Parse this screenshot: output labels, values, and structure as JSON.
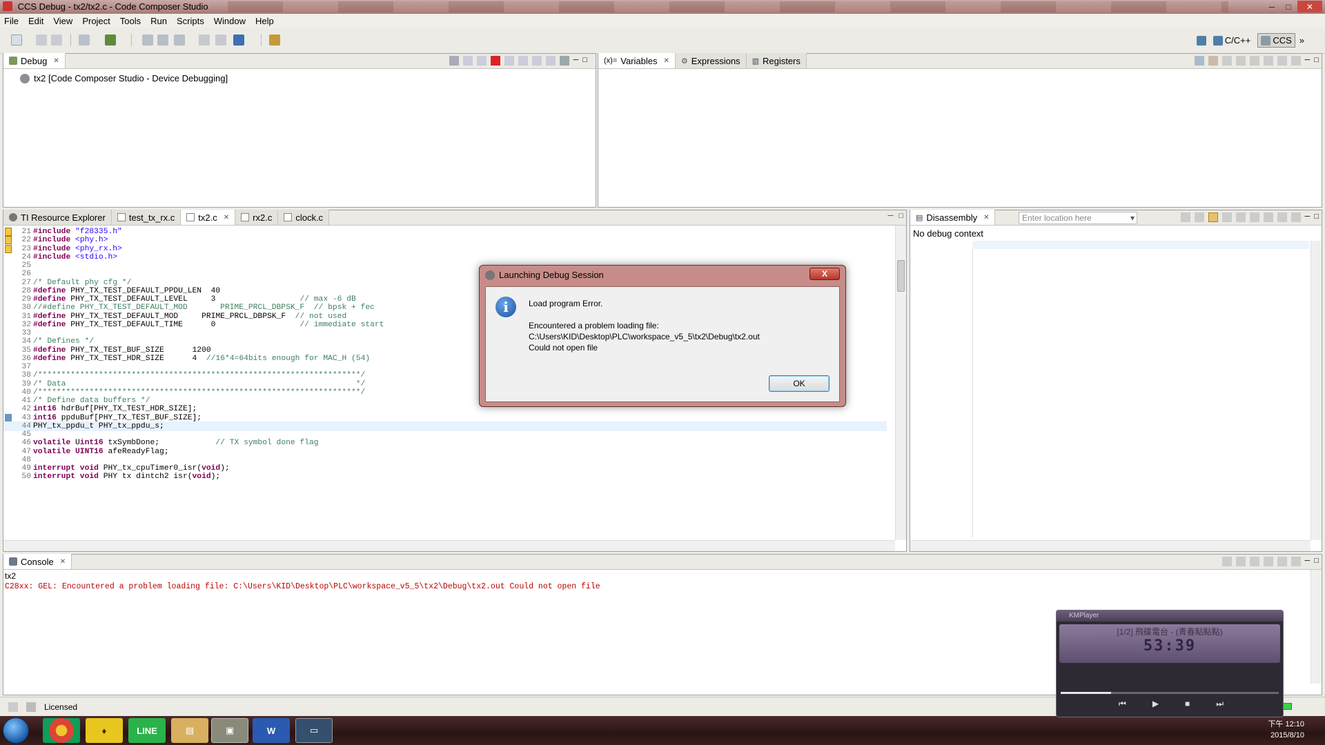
{
  "window": {
    "title": "CCS Debug - tx2/tx2.c - Code Composer Studio"
  },
  "menu": [
    "File",
    "Edit",
    "View",
    "Project",
    "Tools",
    "Run",
    "Scripts",
    "Window",
    "Help"
  ],
  "perspectives": {
    "cpp": "C/C++",
    "ccs": "CCS"
  },
  "debug_view": {
    "tab": "Debug",
    "item": "tx2 [Code Composer Studio - Device Debugging]"
  },
  "variables_view": {
    "tabs": [
      "Variables",
      "Expressions",
      "Registers"
    ]
  },
  "editor": {
    "tabs": [
      "TI Resource Explorer",
      "test_tx_rx.c",
      "tx2.c",
      "rx2.c",
      "clock.c"
    ],
    "active_tab": "tx2.c",
    "lines": [
      {
        "n": "21",
        "t": "#include \"f28335.h\""
      },
      {
        "n": "22",
        "t": "#include <phy.h>"
      },
      {
        "n": "23",
        "t": "#include <phy_rx.h>"
      },
      {
        "n": "24",
        "t": "#include <stdio.h>"
      },
      {
        "n": "25",
        "t": ""
      },
      {
        "n": "26",
        "t": ""
      },
      {
        "n": "27",
        "t": "/* Default phy cfg */"
      },
      {
        "n": "28",
        "t": "#define PHY_TX_TEST_DEFAULT_PPDU_LEN  40"
      },
      {
        "n": "29",
        "t": "#define PHY_TX_TEST_DEFAULT_LEVEL     3                  // max -6 dB"
      },
      {
        "n": "30",
        "t": "//#define PHY_TX_TEST_DEFAULT_MOD       PRIME_PRCL_DBPSK_F  // bpsk + fec"
      },
      {
        "n": "31",
        "t": "#define PHY_TX_TEST_DEFAULT_MOD     PRIME_PRCL_DBPSK_F  // not used"
      },
      {
        "n": "32",
        "t": "#define PHY_TX_TEST_DEFAULT_TIME      0                  // immediate start"
      },
      {
        "n": "33",
        "t": ""
      },
      {
        "n": "34",
        "t": "/* Defines */"
      },
      {
        "n": "35",
        "t": "#define PHY_TX_TEST_BUF_SIZE      1200"
      },
      {
        "n": "36",
        "t": "#define PHY_TX_TEST_HDR_SIZE      4  //16*4=64bits enough for MAC_H (54)"
      },
      {
        "n": "37",
        "t": ""
      },
      {
        "n": "38",
        "t": "/*********************************************************************/"
      },
      {
        "n": "39",
        "t": "/* Data                                                              */"
      },
      {
        "n": "40",
        "t": "/*********************************************************************/"
      },
      {
        "n": "41",
        "t": "/* Define data buffers */"
      },
      {
        "n": "42",
        "t": "int16 hdrBuf[PHY_TX_TEST_HDR_SIZE];"
      },
      {
        "n": "43",
        "t": "int16 ppduBuf[PHY_TX_TEST_BUF_SIZE];"
      },
      {
        "n": "44",
        "t": "PHY_tx_ppdu_t PHY_tx_ppdu_s;"
      },
      {
        "n": "45",
        "t": ""
      },
      {
        "n": "46",
        "t": "volatile Uint16 txSymbDone;            // TX symbol done flag"
      },
      {
        "n": "47",
        "t": "volatile UINT16 afeReadyFlag;"
      },
      {
        "n": "48",
        "t": ""
      },
      {
        "n": "49",
        "t": "interrupt void PHY_tx_cpuTimer0_isr(void);"
      },
      {
        "n": "50",
        "t": "interrupt void PHY tx dintch2 isr(void);"
      }
    ]
  },
  "disassembly": {
    "tab": "Disassembly",
    "location_placeholder": "Enter location here",
    "status": "No debug context"
  },
  "console": {
    "tab": "Console",
    "name": "tx2",
    "message": "C28xx: GEL: Encountered a problem loading file: C:\\Users\\KID\\Desktop\\PLC\\workspace_v5_5\\tx2\\Debug\\tx2.out Could not open file",
    "error_color": "#c00000"
  },
  "status_bar": {
    "license": "Licensed"
  },
  "dialog": {
    "title": "Launching Debug Session",
    "close_label": "X",
    "heading": "Load program Error.",
    "line1": "Encountered a problem loading file:",
    "line2": "C:\\Users\\KID\\Desktop\\PLC\\workspace_v5_5\\tx2\\Debug\\tx2.out",
    "line3": "Could not open file",
    "ok_label": "OK"
  },
  "kmplayer": {
    "title": "KMPlayer",
    "track": "[1/2] 飛碟電台 - (青春點點點)",
    "time": "53:39",
    "progress": 0.23
  },
  "taskbar": {
    "time": "下午 12:10",
    "date": "2015/8/10",
    "apps": [
      "chrome-icon",
      "kakao-icon",
      "line-icon",
      "explorer-icon",
      "virtualbox-icon",
      "word-icon",
      "ccs-icon"
    ]
  }
}
